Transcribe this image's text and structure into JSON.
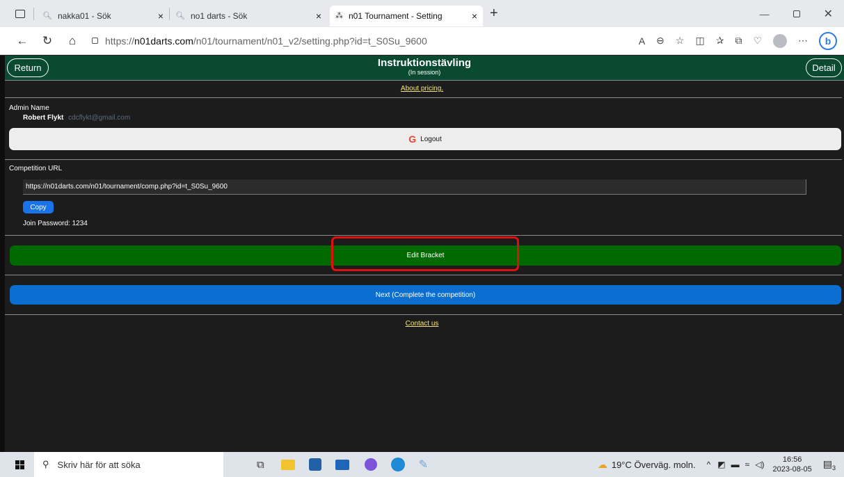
{
  "tabs": [
    {
      "title": "nakka01 - Sök",
      "icon": "search-icon"
    },
    {
      "title": "no1 darts - Sök",
      "icon": "search-icon"
    },
    {
      "title": "n01 Tournament - Setting",
      "icon": "tournament-icon"
    }
  ],
  "url": {
    "prefix": "https://",
    "domain": "n01darts.com",
    "path": "/n01/tournament/n01_v2/setting.php?id=t_S0Su_9600"
  },
  "header": {
    "return_label": "Return",
    "title": "Instruktionstävling",
    "subtitle": "(In session)",
    "detail_label": "Detail"
  },
  "pricing_link": "About pricing.",
  "admin": {
    "label": "Admin Name",
    "name": "Robert Flykt",
    "email": "cdcflykt@gmail.com"
  },
  "logout_label": "Logout",
  "competition": {
    "label": "Competition URL",
    "url": "https://n01darts.com/n01/tournament/comp.php?id=t_S0Su_9600",
    "copy_label": "Copy",
    "password_text": "Join Password: 1234"
  },
  "edit_bracket_label": "Edit Bracket",
  "next_label": "Next (Complete the competition)",
  "contact_label": "Contact us",
  "taskbar": {
    "search_placeholder": "Skriv här för att söka",
    "weather": "19°C Överväg. moln.",
    "time": "16:56",
    "date": "2023-08-05",
    "notif": "3"
  },
  "colors": {
    "header_green": "#0a4a33",
    "edit_green": "#006a00",
    "next_blue": "#0a6fd0",
    "highlight": "#e01010"
  }
}
